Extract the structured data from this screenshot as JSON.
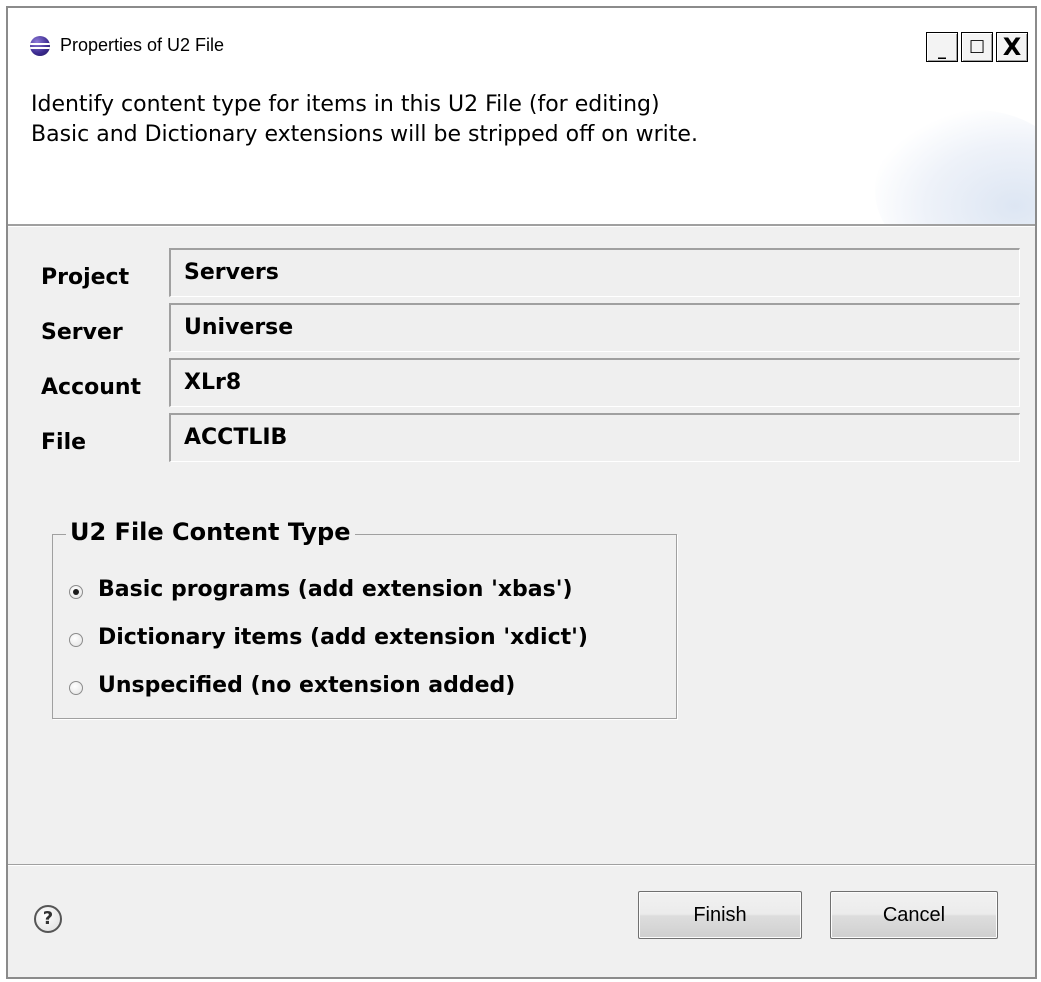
{
  "window": {
    "title": "Properties of U2 File",
    "minimize_label": "_",
    "maximize_label": "□",
    "close_label": "X"
  },
  "header": {
    "line1": "Identify content type for items in this U2 File (for editing)",
    "line2": "Basic and Dictionary extensions will be stripped off on write."
  },
  "fields": {
    "project": {
      "label": "Project",
      "value": "Servers"
    },
    "server": {
      "label": "Server",
      "value": "Universe"
    },
    "account": {
      "label": "Account",
      "value": "XLr8"
    },
    "file": {
      "label": "File",
      "value": "ACCTLIB"
    }
  },
  "content_type": {
    "legend": "U2 File Content Type",
    "options": [
      {
        "label": "Basic programs (add extension 'xbas')",
        "checked": true
      },
      {
        "label": "Dictionary items (add extension 'xdict')",
        "checked": false
      },
      {
        "label": "Unspecified (no extension added)",
        "checked": false
      }
    ]
  },
  "footer": {
    "help_label": "?",
    "finish_label": "Finish",
    "cancel_label": "Cancel"
  },
  "icons": {
    "app": "eclipse-icon",
    "help": "help-icon"
  }
}
